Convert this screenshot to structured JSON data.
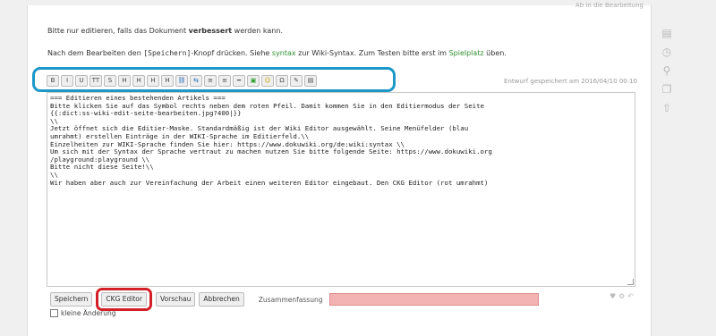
{
  "page": {
    "top_link": "Ab in die Bearbeitung",
    "intro_prefix": "Bitte nur editieren, falls das Dokument ",
    "intro_bold": "verbessert",
    "intro_suffix": " werden kann.",
    "instr_part1": "Nach dem Bearbeiten den ",
    "instr_key": "[Speichern]",
    "instr_part2": "-Knopf drücken. Siehe ",
    "instr_link1": "syntax",
    "instr_part3": " zur Wiki-Syntax. Zum Testen bitte erst im ",
    "instr_link2": "Spielplatz",
    "instr_part4": " üben."
  },
  "toolbar": {
    "buttons": [
      {
        "glyph": "B",
        "name": "bold-button",
        "cls": ""
      },
      {
        "glyph": "I",
        "name": "italic-button",
        "cls": ""
      },
      {
        "glyph": "U",
        "name": "underline-button",
        "cls": ""
      },
      {
        "glyph": "TT",
        "name": "code-button",
        "cls": ""
      },
      {
        "glyph": "S",
        "name": "strike-button",
        "cls": ""
      },
      {
        "glyph": "H",
        "name": "heading-button",
        "cls": ""
      },
      {
        "glyph": "H",
        "name": "heading-lower-button",
        "cls": ""
      },
      {
        "glyph": "H",
        "name": "heading-higher-button",
        "cls": ""
      },
      {
        "glyph": "H",
        "name": "heading-menu-button",
        "cls": ""
      },
      {
        "glyph": "⛓",
        "name": "internal-link-button",
        "cls": "c-blue"
      },
      {
        "glyph": "⇆",
        "name": "external-link-button",
        "cls": "c-blue"
      },
      {
        "glyph": "≡",
        "name": "ordered-list-button",
        "cls": ""
      },
      {
        "glyph": "≡",
        "name": "unordered-list-button",
        "cls": ""
      },
      {
        "glyph": "━",
        "name": "hr-button",
        "cls": ""
      },
      {
        "glyph": "▣",
        "name": "media-button",
        "cls": "c-green"
      },
      {
        "glyph": "☺",
        "name": "smiley-button",
        "cls": "c-yellow"
      },
      {
        "glyph": "Ω",
        "name": "special-chars-button",
        "cls": ""
      },
      {
        "glyph": "✎",
        "name": "signature-button",
        "cls": ""
      },
      {
        "glyph": "▤",
        "name": "table-button",
        "cls": ""
      }
    ],
    "draft_note": "Entwurf gespeichert am 2016/04/10 00:10"
  },
  "editor": {
    "lines": [
      "=== Editieren eines bestehenden Artikels ===",
      "Bitte klicken Sie auf das Symbol rechts neben dem roten Pfeil. Damit kommen Sie in den Editiermodus der Seite",
      "{{:dict:ss-wiki-edit-seite-bearbeiten.jpg?400|}}",
      "\\\\",
      "Jetzt öffnet sich die Editier-Maske. Standardmäßig ist der Wiki Editor ausgewählt. Seine Menüfelder (blau",
      "umrahmt) erstellen Einträge in der WIKI-Sprache im Editierfeld.\\\\",
      "Einzelheiten zur WIKI-Sprache finden Sie hier: https://www.dokuwiki.org/de:wiki:syntax \\\\",
      "Um sich mit der Syntax der Sprache vertraut zu machen nutzen Sie bitte folgende Seite: https://www.dokuwiki.org",
      "/playground:playground \\\\",
      "Bitte nicht diese Seite!\\\\",
      "\\\\",
      "Wir haben aber auch zur Vereinfachung der Arbeit einen weiteren Editor eingebaut. Den CKG Editor (rot umrahmt)"
    ]
  },
  "form": {
    "save": "Speichern",
    "ckg": "CKG Editor",
    "preview": "Vorschau",
    "cancel": "Abbrechen",
    "summary_label": "Zusammenfassung",
    "minor_label": "kleine Änderung"
  },
  "colors": {
    "toolbar_highlight": "#1c98c8",
    "ckg_highlight": "#d32027",
    "summary_bg": "#f4b3b3"
  },
  "sidebar_icons": [
    "page-icon",
    "revisions-icon",
    "backlinks-icon",
    "copy-icon",
    "top-icon"
  ]
}
